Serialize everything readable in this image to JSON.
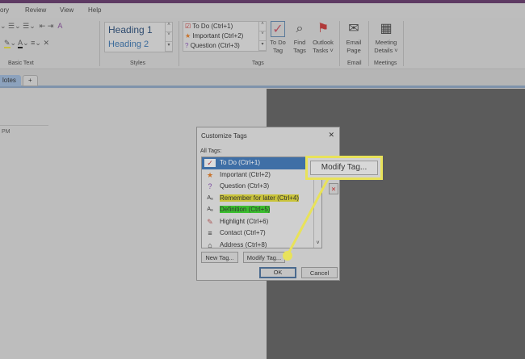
{
  "menu": [
    "ory",
    "Review",
    "View",
    "Help"
  ],
  "ribbon": {
    "groups": {
      "basic_text": "Basic Text",
      "styles": "Styles",
      "tags": "Tags",
      "email": "Email",
      "meetings": "Meetings"
    },
    "styles": [
      "Heading 1",
      "Heading 2"
    ],
    "tags": [
      "To Do (Ctrl+1)",
      "Important (Ctrl+2)",
      "Question (Ctrl+3)"
    ],
    "buttons": {
      "todo": "To Do Tag",
      "find": "Find Tags",
      "outlook": "Outlook Tasks ˅",
      "email": "Email Page",
      "meeting": "Meeting Details ˅"
    }
  },
  "tabs": {
    "active": "lotes",
    "add": "+"
  },
  "page": {
    "time": "PM"
  },
  "dialog": {
    "title": "Customize Tags",
    "close": "✕",
    "list_label": "All Tags:",
    "items": [
      "To Do (Ctrl+1)",
      "Important (Ctrl+2)",
      "Question (Ctrl+3)",
      "Remember for later (Ctrl+4)",
      "Definition (Ctrl+5)",
      "Highlight (Ctrl+6)",
      "Contact (Ctrl+7)",
      "Address (Ctrl+8)"
    ],
    "new_tag": "New Tag...",
    "modify_tag": "Modify Tag...",
    "ok": "OK",
    "cancel": "Cancel"
  },
  "callout": {
    "label": "Modify Tag...",
    "color": "#e8e25a"
  }
}
